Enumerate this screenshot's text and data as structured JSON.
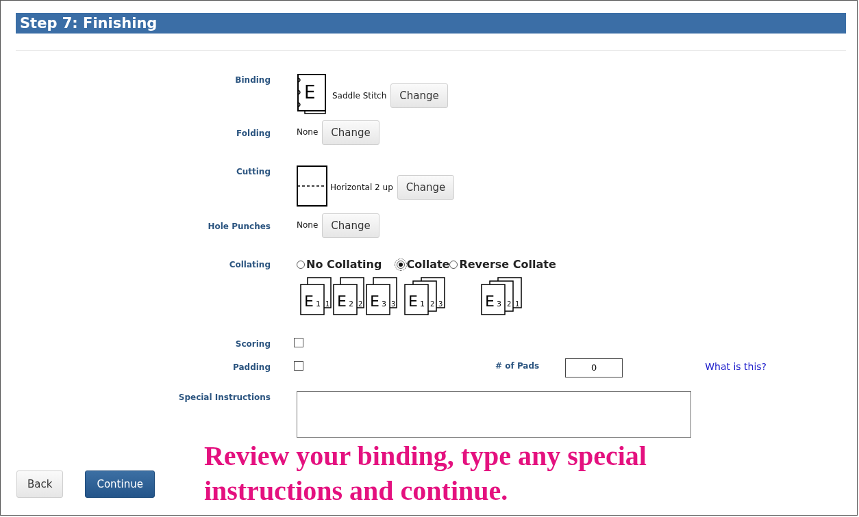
{
  "header": {
    "title": "Step 7: Finishing"
  },
  "binding": {
    "label": "Binding",
    "letter": "E",
    "value": "Saddle Stitch",
    "button": "Change"
  },
  "folding": {
    "label": "Folding",
    "value": "None",
    "button": "Change"
  },
  "cutting": {
    "label": "Cutting",
    "value": "Horizontal 2 up",
    "button": "Change"
  },
  "hole_punches": {
    "label": "Hole Punches",
    "value": "None",
    "button": "Change"
  },
  "collating": {
    "label": "Collating",
    "options": [
      {
        "label": "No Collating",
        "selected": false
      },
      {
        "label": "Collate",
        "selected": true
      },
      {
        "label": "Reverse Collate",
        "selected": false
      }
    ],
    "illustrations": [
      {
        "kind": "uncollated",
        "stacks": [
          {
            "letter": "E",
            "front": "1",
            "back": "1"
          },
          {
            "letter": "E",
            "front": "2",
            "back": "2"
          },
          {
            "letter": "E",
            "front": "3",
            "back": "3"
          }
        ]
      },
      {
        "kind": "collated",
        "letter": "E",
        "pages": [
          "1",
          "2",
          "3"
        ]
      },
      {
        "kind": "collated",
        "letter": "E",
        "pages": [
          "3",
          "2",
          "1"
        ]
      }
    ]
  },
  "scoring": {
    "label": "Scoring",
    "checked": false
  },
  "padding": {
    "label": "Padding",
    "checked": false,
    "pads_label": "# of Pads",
    "pads_value": "0",
    "help_link": "What is this?"
  },
  "special_instructions": {
    "label": "Special Instructions"
  },
  "buttons": [
    {
      "label": "Back",
      "kind": "secondary"
    },
    {
      "label": "Continue",
      "kind": "primary"
    }
  ],
  "annotation": "Review your binding, type any special instructions and continue."
}
